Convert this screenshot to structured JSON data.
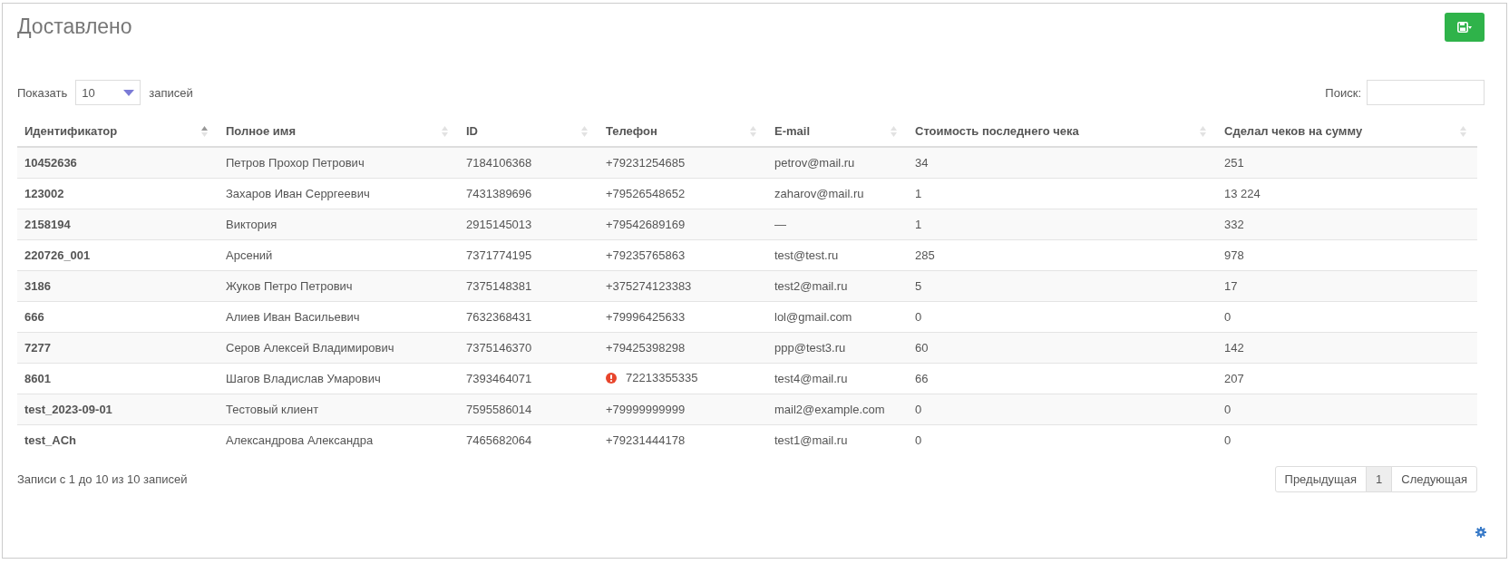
{
  "title": "Доставлено",
  "length_control": {
    "label_before": "Показать",
    "value": "10",
    "label_after": "записей"
  },
  "search": {
    "label": "Поиск:"
  },
  "table": {
    "columns": [
      {
        "label": "Идентификатор",
        "sorted": true
      },
      {
        "label": "Полное имя",
        "sorted": false
      },
      {
        "label": "ID",
        "sorted": false
      },
      {
        "label": "Телефон",
        "sorted": false
      },
      {
        "label": "E-mail",
        "sorted": false
      },
      {
        "label": "Стоимость последнего чека",
        "sorted": false
      },
      {
        "label": "Сделал чеков на сумму",
        "sorted": false
      }
    ],
    "rows": [
      {
        "cells": [
          "10452636",
          "Петров Прохор Петрович",
          "7184106368",
          "+79231254685",
          "petrov@mail.ru",
          "34",
          "251"
        ],
        "phone_warning": false
      },
      {
        "cells": [
          "123002",
          "Захаров Иван Серргеевич",
          "7431389696",
          "+79526548652",
          "zaharov@mail.ru",
          "1",
          "13 224"
        ],
        "phone_warning": false
      },
      {
        "cells": [
          "2158194",
          "Виктория",
          "2915145013",
          "+79542689169",
          "—",
          "1",
          "332"
        ],
        "phone_warning": false
      },
      {
        "cells": [
          "220726_001",
          "Арсений",
          "7371774195",
          "+79235765863",
          "test@test.ru",
          "285",
          "978"
        ],
        "phone_warning": false
      },
      {
        "cells": [
          "3186",
          "Жуков Петро Петрович",
          "7375148381",
          "+375274123383",
          "test2@mail.ru",
          "5",
          "17"
        ],
        "phone_warning": false
      },
      {
        "cells": [
          "666",
          "Алиев Иван Васильевич",
          "7632368431",
          "+79996425633",
          "lol@gmail.com",
          "0",
          "0"
        ],
        "phone_warning": false
      },
      {
        "cells": [
          "7277",
          "Серов Алексей Владимирович",
          "7375146370",
          "+79425398298",
          "ppp@test3.ru",
          "60",
          "142"
        ],
        "phone_warning": false
      },
      {
        "cells": [
          "8601",
          "Шагов Владислав Умарович",
          "7393464071",
          "72213355335",
          "test4@mail.ru",
          "66",
          "207"
        ],
        "phone_warning": true
      },
      {
        "cells": [
          "test_2023-09-01",
          "Тестовый клиент",
          "7595586014",
          "+79999999999",
          "mail2@example.com",
          "0",
          "0"
        ],
        "phone_warning": false
      },
      {
        "cells": [
          "test_ACh",
          "Александрова Александра",
          "7465682064",
          "+79231444178",
          "test1@mail.ru",
          "0",
          "0"
        ],
        "phone_warning": false
      }
    ]
  },
  "info": "Записи с 1 до 10 из 10 записей",
  "pagination": [
    {
      "label": "Предыдущая",
      "selected": false
    },
    {
      "label": "1",
      "selected": true
    },
    {
      "label": "Следующая",
      "selected": false
    }
  ]
}
